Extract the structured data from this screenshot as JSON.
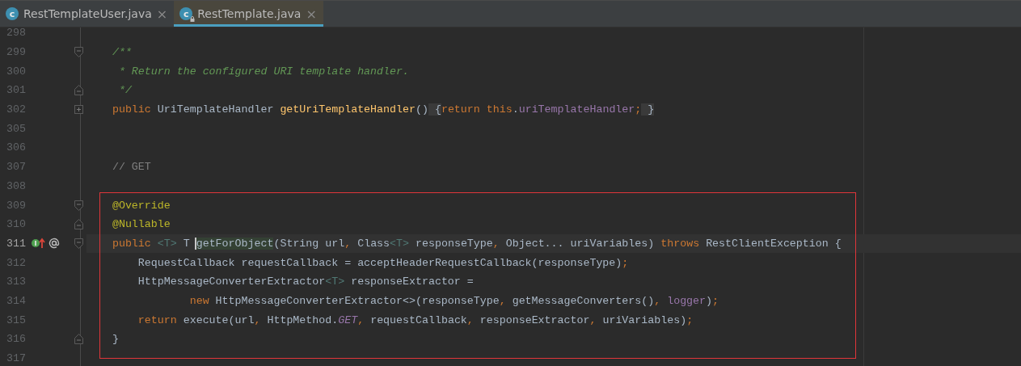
{
  "tabs": [
    {
      "icon_letter": "c",
      "label": "RestTemplateUser.java",
      "close": "×",
      "selected": false,
      "locked": false
    },
    {
      "icon_letter": "c",
      "label": "RestTemplate.java",
      "close": "×",
      "selected": true,
      "locked": true
    }
  ],
  "lines": [
    {
      "number": "298",
      "fold_start": false,
      "fold_end": false,
      "folded": false,
      "current": false,
      "boxed": false
    },
    {
      "number": "299",
      "fold_start": true,
      "fold_end": false,
      "folded": false,
      "current": false,
      "boxed": false,
      "tokens": [
        {
          "kind": "doc",
          "text": "    /**"
        }
      ]
    },
    {
      "number": "300",
      "fold_start": false,
      "fold_end": false,
      "folded": false,
      "current": false,
      "boxed": false,
      "tokens": [
        {
          "kind": "doc",
          "text": "     * Return the configured URI template handler."
        }
      ]
    },
    {
      "number": "301",
      "fold_start": false,
      "fold_end": true,
      "folded": false,
      "current": false,
      "boxed": false,
      "tokens": [
        {
          "kind": "doc",
          "text": "     */"
        }
      ]
    },
    {
      "number": "302",
      "fold_start": false,
      "fold_end": false,
      "folded": true,
      "current": false,
      "boxed": false,
      "tokens": [
        {
          "kind": "keyword",
          "text": "    public"
        },
        {
          "kind": "plain",
          "text": " UriTemplateHandler "
        },
        {
          "kind": "method",
          "text": "getUriTemplateHandler"
        },
        {
          "kind": "plain",
          "text": "()"
        },
        {
          "kind": "folded",
          "text": " {"
        },
        {
          "kind": "keyword",
          "text": "return this"
        },
        {
          "kind": "plain",
          "text": "."
        },
        {
          "kind": "field",
          "text": "uriTemplateHandler"
        },
        {
          "kind": "punct",
          "text": ";"
        },
        {
          "kind": "folded",
          "text": " }"
        }
      ]
    },
    {
      "number": "305",
      "fold_start": false,
      "fold_end": false,
      "folded": false,
      "current": false,
      "boxed": false
    },
    {
      "number": "306",
      "fold_start": false,
      "fold_end": false,
      "folded": false,
      "current": false,
      "boxed": false
    },
    {
      "number": "307",
      "fold_start": false,
      "fold_end": false,
      "folded": false,
      "current": false,
      "boxed": false,
      "tokens": [
        {
          "kind": "comment",
          "text": "    // GET"
        }
      ]
    },
    {
      "number": "308",
      "fold_start": false,
      "fold_end": false,
      "folded": false,
      "current": false,
      "boxed": false
    },
    {
      "number": "309",
      "fold_start": true,
      "fold_end": false,
      "folded": false,
      "current": false,
      "boxed": true,
      "tokens": [
        {
          "kind": "annotation",
          "text": "    @Override"
        }
      ]
    },
    {
      "number": "310",
      "fold_start": false,
      "fold_end": true,
      "folded": false,
      "current": false,
      "boxed": true,
      "tokens": [
        {
          "kind": "annotation",
          "text": "    @Nullable"
        }
      ]
    },
    {
      "number": "311",
      "fold_start": true,
      "fold_end": false,
      "folded": false,
      "current": true,
      "boxed": true,
      "gutter_icons": [
        {
          "kind": "implements"
        },
        {
          "kind": "annotation"
        }
      ],
      "tokens": [
        {
          "kind": "keyword",
          "text": "    public"
        },
        {
          "kind": "typeparam",
          "text": " <T>"
        },
        {
          "kind": "plain",
          "text": " T "
        },
        {
          "kind": "usage",
          "text": "getForObject"
        },
        {
          "kind": "plain",
          "text": "(String url"
        },
        {
          "kind": "punct",
          "text": ","
        },
        {
          "kind": "plain",
          "text": " Class"
        },
        {
          "kind": "typeparam",
          "text": "<T>"
        },
        {
          "kind": "plain",
          "text": " responseType"
        },
        {
          "kind": "punct",
          "text": ","
        },
        {
          "kind": "plain",
          "text": " Object... uriVariables) "
        },
        {
          "kind": "keyword",
          "text": "throws"
        },
        {
          "kind": "plain",
          "text": " RestClientException {"
        }
      ]
    },
    {
      "number": "312",
      "fold_start": false,
      "fold_end": false,
      "folded": false,
      "current": false,
      "boxed": true,
      "tokens": [
        {
          "kind": "plain",
          "text": "        RequestCallback requestCallback = acceptHeaderRequestCallback(responseType)"
        },
        {
          "kind": "punct",
          "text": ";"
        }
      ]
    },
    {
      "number": "313",
      "fold_start": false,
      "fold_end": false,
      "folded": false,
      "current": false,
      "boxed": true,
      "tokens": [
        {
          "kind": "plain",
          "text": "        HttpMessageConverterExtractor"
        },
        {
          "kind": "typeparam",
          "text": "<T>"
        },
        {
          "kind": "plain",
          "text": " responseExtractor ="
        }
      ]
    },
    {
      "number": "314",
      "fold_start": false,
      "fold_end": false,
      "folded": false,
      "current": false,
      "boxed": true,
      "tokens": [
        {
          "kind": "keyword",
          "text": "                new"
        },
        {
          "kind": "plain",
          "text": " HttpMessageConverterExtractor<>(responseType"
        },
        {
          "kind": "punct",
          "text": ","
        },
        {
          "kind": "plain",
          "text": " getMessageConverters()"
        },
        {
          "kind": "punct",
          "text": ","
        },
        {
          "kind": "field",
          "text": " logger"
        },
        {
          "kind": "plain",
          "text": ")"
        },
        {
          "kind": "punct",
          "text": ";"
        }
      ]
    },
    {
      "number": "315",
      "fold_start": false,
      "fold_end": false,
      "folded": false,
      "current": false,
      "boxed": true,
      "tokens": [
        {
          "kind": "keyword",
          "text": "        return"
        },
        {
          "kind": "plain",
          "text": " execute(url"
        },
        {
          "kind": "punct",
          "text": ","
        },
        {
          "kind": "plain",
          "text": " HttpMethod."
        },
        {
          "kind": "static",
          "text": "GET"
        },
        {
          "kind": "punct",
          "text": ","
        },
        {
          "kind": "plain",
          "text": " requestCallback"
        },
        {
          "kind": "punct",
          "text": ","
        },
        {
          "kind": "plain",
          "text": " responseExtractor"
        },
        {
          "kind": "punct",
          "text": ","
        },
        {
          "kind": "plain",
          "text": " uriVariables)"
        },
        {
          "kind": "punct",
          "text": ";"
        }
      ]
    },
    {
      "number": "316",
      "fold_start": false,
      "fold_end": true,
      "folded": false,
      "current": false,
      "boxed": true,
      "tokens": [
        {
          "kind": "plain",
          "text": "    }"
        }
      ]
    },
    {
      "number": "317",
      "fold_start": false,
      "fold_end": false,
      "folded": false,
      "current": false,
      "boxed": false
    }
  ]
}
